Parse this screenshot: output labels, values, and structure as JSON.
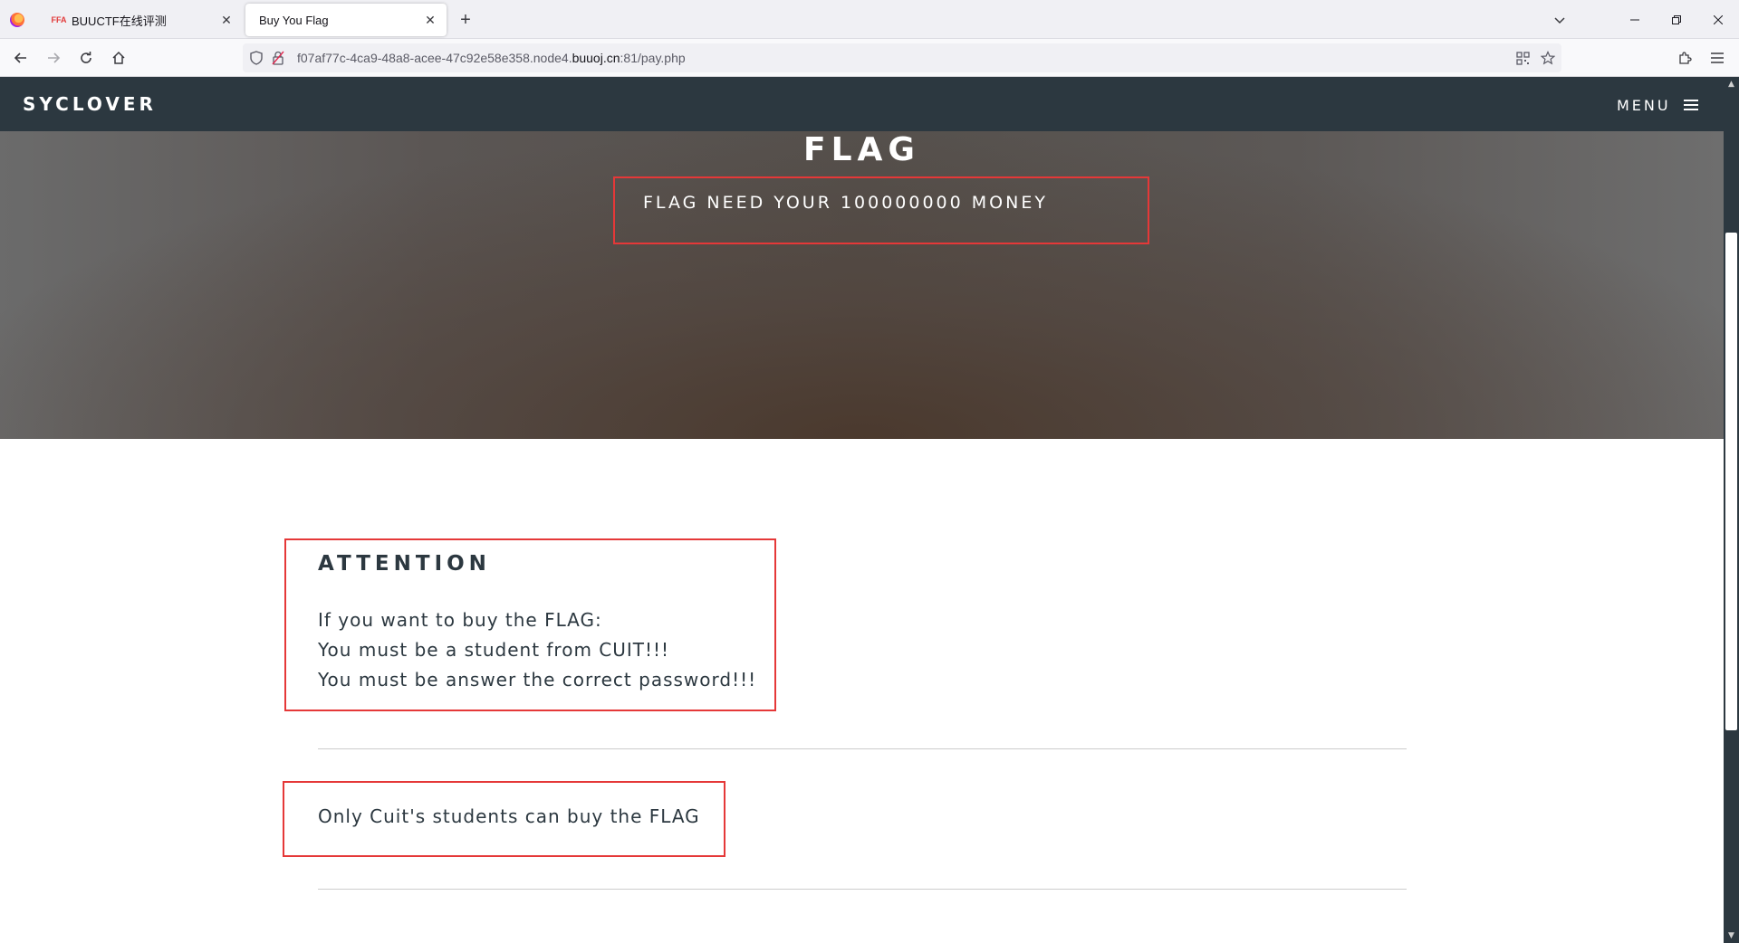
{
  "browser": {
    "tabs": [
      {
        "favicon": "buuctf-favicon",
        "title": "BUUCTF在线评测",
        "active": false
      },
      {
        "favicon": "",
        "title": "Buy You Flag",
        "active": true
      }
    ],
    "url": {
      "prefix": "f07af77c-4ca9-48a8-acee-47c92e58e358.node4.",
      "host": "buuoj.cn",
      "suffix": ":81/pay.php"
    }
  },
  "site": {
    "brand": "SYCLOVER",
    "menu_label": "MENU"
  },
  "hero": {
    "title": "FLAG",
    "subtitle": "FLAG NEED YOUR 100000000 MONEY"
  },
  "attention": {
    "heading": "ATTENTION",
    "lines": [
      "If you want to buy the FLAG:",
      "You must be a student from CUIT!!!",
      "You must be answer the correct password!!!"
    ]
  },
  "notice": "Only Cuit's students can buy the FLAG",
  "colors": {
    "nav_background": "#2c3840",
    "highlight_border": "#e53838",
    "text_dark": "#2c3840"
  }
}
